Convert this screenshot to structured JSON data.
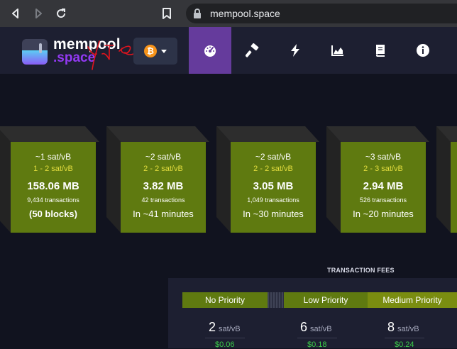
{
  "browser": {
    "url": "mempool.space",
    "icons": [
      "back-arrow-icon",
      "forward-arrow-icon",
      "reload-icon",
      "bookmark-icon",
      "lock-icon"
    ]
  },
  "header": {
    "logo_line1": "mempool",
    "logo_line2": ".space",
    "network_symbol": "₿",
    "menu": [
      "dashboard-icon",
      "mining-hammer-icon",
      "lightning-icon",
      "graphs-icon",
      "docs-book-icon",
      "about-info-icon"
    ],
    "active_menu": "dashboard-icon",
    "accent": "#653b9c"
  },
  "blocks": [
    {
      "fee": "~1 sat/vB",
      "range": "1 - 2 sat/vB",
      "size": "158.06 MB",
      "txs": "9,434 transactions",
      "time": "(50 blocks)"
    },
    {
      "fee": "~2 sat/vB",
      "range": "2 - 2 sat/vB",
      "size": "3.82 MB",
      "txs": "42 transactions",
      "time": "In ~41 minutes"
    },
    {
      "fee": "~2 sat/vB",
      "range": "2 - 2 sat/vB",
      "size": "3.05 MB",
      "txs": "1,049 transactions",
      "time": "In ~30 minutes"
    },
    {
      "fee": "~3 sat/vB",
      "range": "2 - 3 sat/vB",
      "size": "2.94 MB",
      "txs": "526 transactions",
      "time": "In ~20 minutes"
    }
  ],
  "fees": {
    "title": "TRANSACTION FEES",
    "priorities": [
      {
        "label": "No Priority",
        "value": "2",
        "unit": "sat/vB",
        "usd": "$0.06"
      },
      {
        "label": "Low Priority",
        "value": "6",
        "unit": "sat/vB",
        "usd": "$0.18"
      },
      {
        "label": "Medium Priority",
        "value": "8",
        "unit": "sat/vB",
        "usd": "$0.24"
      }
    ]
  }
}
